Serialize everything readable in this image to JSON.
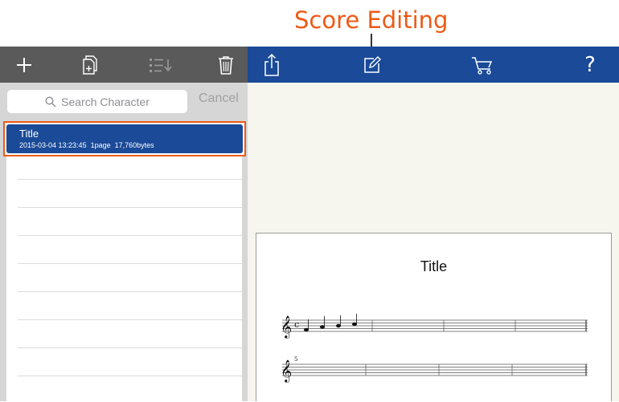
{
  "callout": {
    "label": "Score Editing"
  },
  "left_toolbar": {
    "buttons": [
      {
        "icon": "plus-icon"
      },
      {
        "icon": "duplicate-icon"
      },
      {
        "icon": "sort-icon"
      },
      {
        "icon": "trash-icon"
      }
    ]
  },
  "right_toolbar": {
    "buttons": [
      {
        "icon": "share-icon"
      },
      {
        "icon": "edit-icon"
      },
      {
        "icon": "cart-icon"
      },
      {
        "icon": "help-icon",
        "label": "?"
      }
    ]
  },
  "search": {
    "placeholder": "Search Character",
    "cancel_label": "Cancel"
  },
  "file_list": [
    {
      "title": "Title",
      "date": "2015-03-04 13:23:45",
      "pages": "1page",
      "size": "17,760bytes",
      "selected": true
    }
  ],
  "score": {
    "title": "Title",
    "second_staff_measure_number": "5",
    "time_signature": "c"
  },
  "colors": {
    "accent": "#ee5a16",
    "toolbar_blue": "#1a4a98",
    "toolbar_gray": "#5a5a5a"
  }
}
